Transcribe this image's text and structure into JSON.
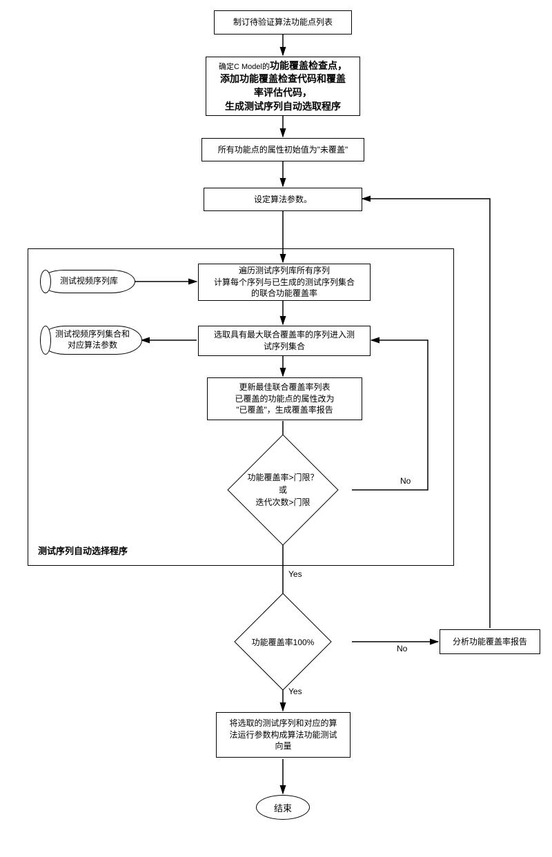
{
  "chart_data": {
    "type": "flowchart",
    "nodes": [
      {
        "id": "n1",
        "type": "process",
        "text": "制订待验证算法功能点列表"
      },
      {
        "id": "n2",
        "type": "process",
        "text": "确定C Model的功能覆盖检查点，\n添加功能覆盖检查代码和覆盖率评估代码，\n生成测试序列自动选取程序"
      },
      {
        "id": "n3",
        "type": "process",
        "text": "所有功能点的属性初始值为\"未覆盖\""
      },
      {
        "id": "n4",
        "type": "process",
        "text": "设定算法参数。"
      },
      {
        "id": "ds1",
        "type": "datastore",
        "text": "测试视频序列库"
      },
      {
        "id": "n5",
        "type": "process",
        "text": "遍历测试序列库所有序列\n计算每个序列与已生成的测试序列集合的联合功能覆盖率"
      },
      {
        "id": "ds2",
        "type": "datastore",
        "text": "测试视频序列集合和对应算法参数"
      },
      {
        "id": "n6",
        "type": "process",
        "text": "选取具有最大联合覆盖率的序列进入测试序列集合"
      },
      {
        "id": "n7",
        "type": "process",
        "text": "更新最佳联合覆盖率列表\n已覆盖的功能点的属性改为\"已覆盖\"，生成覆盖率报告"
      },
      {
        "id": "d1",
        "type": "decision",
        "text": "功能覆盖率>门限？\n或\n迭代次数>门限"
      },
      {
        "id": "d2",
        "type": "decision",
        "text": "功能覆盖率100%"
      },
      {
        "id": "n8",
        "type": "process",
        "text": "分析功能覆盖率报告"
      },
      {
        "id": "n9",
        "type": "process",
        "text": "将选取的测试序列和对应的算法运行参数构成算法功能测试向量"
      },
      {
        "id": "end",
        "type": "terminal",
        "text": "结束"
      }
    ],
    "edges": [
      {
        "from": "n1",
        "to": "n2"
      },
      {
        "from": "n2",
        "to": "n3"
      },
      {
        "from": "n3",
        "to": "n4"
      },
      {
        "from": "n4",
        "to": "n5"
      },
      {
        "from": "ds1",
        "to": "n5"
      },
      {
        "from": "n5",
        "to": "n6"
      },
      {
        "from": "n6",
        "to": "ds2"
      },
      {
        "from": "n6",
        "to": "n7"
      },
      {
        "from": "n7",
        "to": "d1"
      },
      {
        "from": "d1",
        "to": "n6",
        "label": "No"
      },
      {
        "from": "d1",
        "to": "d2",
        "label": "Yes"
      },
      {
        "from": "d2",
        "to": "n8",
        "label": "No"
      },
      {
        "from": "n8",
        "to": "n4"
      },
      {
        "from": "d2",
        "to": "n9",
        "label": "Yes"
      },
      {
        "from": "n9",
        "to": "end"
      }
    ],
    "group": {
      "label": "测试序列自动选择程序",
      "contains": [
        "ds1",
        "n5",
        "ds2",
        "n6",
        "n7",
        "d1"
      ]
    }
  },
  "nodes": {
    "n1": "制订待验证算法功能点列表",
    "n2_line1": "确定C Model的",
    "n2_line1b": "功能覆盖检查点，",
    "n2_line2a": "添加功能覆盖检查代码和覆盖",
    "n2_line2b": "率评估代码，",
    "n2_line3": "生成测试序列自动选取程序",
    "n3": "所有功能点的属性初始值为\"未覆盖\"",
    "n4": "设定算法参数。",
    "ds1": "测试视频序列库",
    "n5_l1": "遍历测试序列库所有序列",
    "n5_l2": "计算每个序列与已生成的测试序列集合",
    "n5_l3": "的联合功能覆盖率",
    "ds2_l1": "测试视频序列集合和",
    "ds2_l2": "对应算法参数",
    "n6_l1": "选取具有最大联合覆盖率的序列进入测",
    "n6_l2": "试序列集合",
    "n7_l1": "更新最佳联合覆盖率列表",
    "n7_l2": "已覆盖的功能点的属性改为",
    "n7_l3": "\"已覆盖\"，生成覆盖率报告",
    "d1_l1": "功能覆盖率>门限？",
    "d1_l2": "或",
    "d1_l3": "迭代次数>门限",
    "d2": "功能覆盖率100%",
    "n8": "分析功能覆盖率报告",
    "n9_l1": "将选取的测试序列和对应的算",
    "n9_l2": "法运行参数构成算法功能测试",
    "n9_l3": "向量",
    "end": "结束"
  },
  "labels": {
    "no": "No",
    "yes": "Yes",
    "group": "测试序列自动选择程序"
  }
}
